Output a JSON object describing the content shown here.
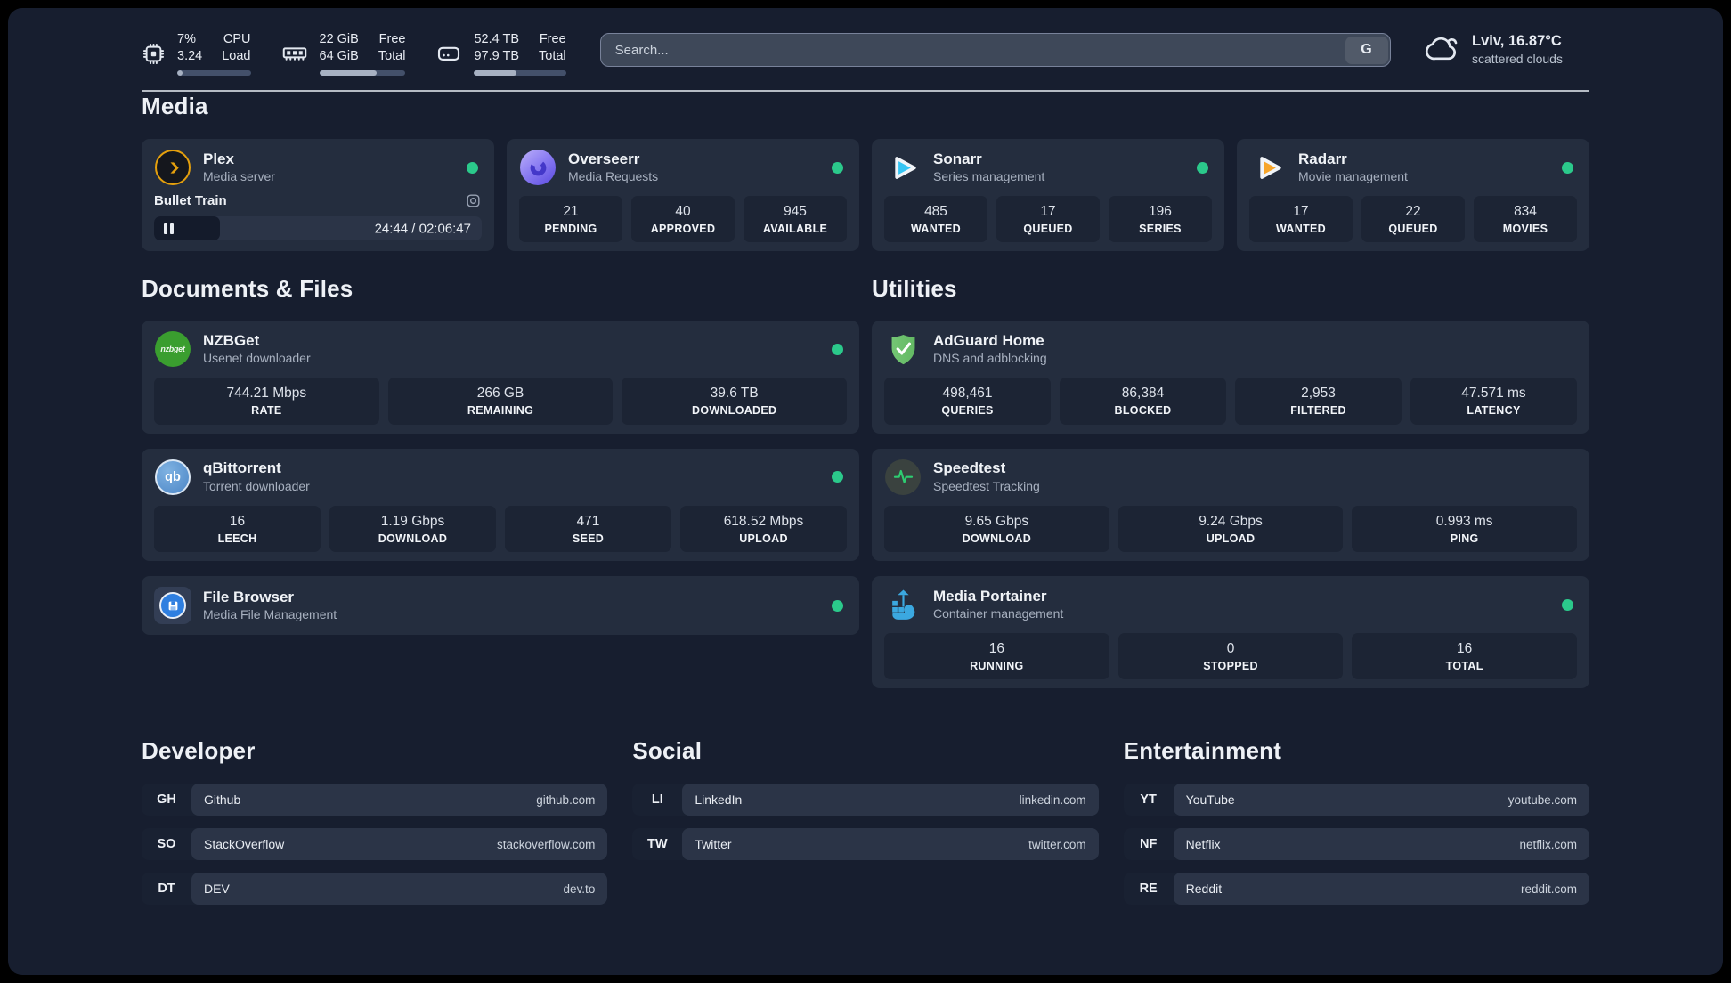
{
  "header": {
    "system": [
      {
        "icon": "cpu-icon",
        "value_top": "7%",
        "value_bottom": "3.24",
        "label_top": "CPU",
        "label_bottom": "Load",
        "progress_pct": 7
      },
      {
        "icon": "ram-icon",
        "value_top": "22 GiB",
        "value_bottom": "64 GiB",
        "label_top": "Free",
        "label_bottom": "Total",
        "progress_pct": 66
      },
      {
        "icon": "disk-icon",
        "value_top": "52.4 TB",
        "value_bottom": "97.9 TB",
        "label_top": "Free",
        "label_bottom": "Total",
        "progress_pct": 46
      }
    ],
    "search": {
      "placeholder": "Search...",
      "provider_label": "G"
    },
    "weather": {
      "icon": "cloud-icon",
      "title": "Lviv, 16.87°C",
      "subtitle": "scattered clouds"
    }
  },
  "media_section": {
    "title": "Media",
    "cards": [
      {
        "icon": "plex-icon",
        "name": "Plex",
        "description": "Media server",
        "status": "online",
        "now_playing": {
          "title": "Bullet Train",
          "time": "24:44 / 02:06:47",
          "progress_pct": 20
        }
      },
      {
        "icon": "overseerr-icon",
        "name": "Overseerr",
        "description": "Media Requests",
        "status": "online",
        "stats": [
          {
            "value": "21",
            "label": "PENDING"
          },
          {
            "value": "40",
            "label": "APPROVED"
          },
          {
            "value": "945",
            "label": "AVAILABLE"
          }
        ]
      },
      {
        "icon": "sonarr-icon",
        "name": "Sonarr",
        "description": "Series management",
        "status": "online",
        "stats": [
          {
            "value": "485",
            "label": "WANTED"
          },
          {
            "value": "17",
            "label": "QUEUED"
          },
          {
            "value": "196",
            "label": "SERIES"
          }
        ]
      },
      {
        "icon": "radarr-icon",
        "name": "Radarr",
        "description": "Movie management",
        "status": "online",
        "stats": [
          {
            "value": "17",
            "label": "WANTED"
          },
          {
            "value": "22",
            "label": "QUEUED"
          },
          {
            "value": "834",
            "label": "MOVIES"
          }
        ]
      }
    ]
  },
  "documents_section": {
    "title": "Documents & Files",
    "cards": [
      {
        "icon": "nzbget-icon",
        "name": "NZBGet",
        "description": "Usenet downloader",
        "status": "online",
        "stats": [
          {
            "value": "744.21 Mbps",
            "label": "RATE"
          },
          {
            "value": "266 GB",
            "label": "REMAINING"
          },
          {
            "value": "39.6 TB",
            "label": "DOWNLOADED"
          }
        ]
      },
      {
        "icon": "qbittorrent-icon",
        "name": "qBittorrent",
        "description": "Torrent downloader",
        "status": "online",
        "stats": [
          {
            "value": "16",
            "label": "LEECH"
          },
          {
            "value": "1.19 Gbps",
            "label": "DOWNLOAD"
          },
          {
            "value": "471",
            "label": "SEED"
          },
          {
            "value": "618.52 Mbps",
            "label": "UPLOAD"
          }
        ]
      },
      {
        "icon": "filebrowser-icon",
        "name": "File Browser",
        "description": "Media File Management",
        "status": "online"
      }
    ]
  },
  "utilities_section": {
    "title": "Utilities",
    "cards": [
      {
        "icon": "adguard-icon",
        "name": "AdGuard Home",
        "description": "DNS and adblocking",
        "status": null,
        "stats": [
          {
            "value": "498,461",
            "label": "QUERIES"
          },
          {
            "value": "86,384",
            "label": "BLOCKED"
          },
          {
            "value": "2,953",
            "label": "FILTERED"
          },
          {
            "value": "47.571 ms",
            "label": "LATENCY"
          }
        ]
      },
      {
        "icon": "speedtest-icon",
        "name": "Speedtest",
        "description": "Speedtest Tracking",
        "status": null,
        "stats": [
          {
            "value": "9.65 Gbps",
            "label": "DOWNLOAD"
          },
          {
            "value": "9.24 Gbps",
            "label": "UPLOAD"
          },
          {
            "value": "0.993 ms",
            "label": "PING"
          }
        ]
      },
      {
        "icon": "portainer-icon",
        "name": "Media Portainer",
        "description": "Container management",
        "status": "online",
        "stats": [
          {
            "value": "16",
            "label": "RUNNING"
          },
          {
            "value": "0",
            "label": "STOPPED"
          },
          {
            "value": "16",
            "label": "TOTAL"
          }
        ]
      }
    ]
  },
  "link_sections": [
    {
      "title": "Developer",
      "links": [
        {
          "abbr": "GH",
          "name": "Github",
          "url": "github.com"
        },
        {
          "abbr": "SO",
          "name": "StackOverflow",
          "url": "stackoverflow.com"
        },
        {
          "abbr": "DT",
          "name": "DEV",
          "url": "dev.to"
        }
      ]
    },
    {
      "title": "Social",
      "links": [
        {
          "abbr": "LI",
          "name": "LinkedIn",
          "url": "linkedin.com"
        },
        {
          "abbr": "TW",
          "name": "Twitter",
          "url": "twitter.com"
        }
      ]
    },
    {
      "title": "Entertainment",
      "links": [
        {
          "abbr": "YT",
          "name": "YouTube",
          "url": "youtube.com"
        },
        {
          "abbr": "NF",
          "name": "Netflix",
          "url": "netflix.com"
        },
        {
          "abbr": "RE",
          "name": "Reddit",
          "url": "reddit.com"
        }
      ]
    }
  ],
  "colors": {
    "bg": "#171e2f",
    "card": "#242d3e",
    "box": "#1c2434",
    "link_pill": "#2b3447",
    "link_pill_dark": "#192132",
    "status_green": "#2bc98b",
    "divider": "#ccd2da",
    "search_bg": "#3e4859",
    "search_border": "#78829a",
    "plex_amber": "#e5a00d",
    "overseerr_purple": "#6c5ce7",
    "sonarr_blue": "#35c5f4",
    "radarr_orange": "#f7a52a",
    "nzbget_green": "#3a9e2f",
    "qbittorrent_blue": "#4c86c6",
    "filebrowser_blue": "#2f7fe0",
    "adguard_green": "#63b963",
    "speedtest_green": "#2ecc71",
    "portainer_blue": "#3ba8e0"
  }
}
